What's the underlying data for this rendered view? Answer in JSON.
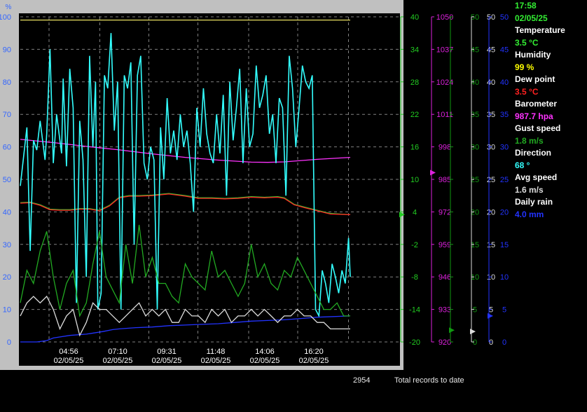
{
  "status": {
    "time": "17:58",
    "date": "02/05/25",
    "readings": [
      {
        "label": "Temperature",
        "value": "3.5 °C",
        "color": "#33ee33"
      },
      {
        "label": "Humidity",
        "value": "99 %",
        "color": "#ffff00"
      },
      {
        "label": "Dew point",
        "value": "3.5 °C",
        "color": "#ff2020"
      },
      {
        "label": "Barometer",
        "value": "987.7 hpa",
        "color": "#ff33ff"
      },
      {
        "label": "Gust speed",
        "value": "1.8 m/s",
        "color": "#22aa22"
      },
      {
        "label": "Direction",
        "value": "68 °",
        "color": "#33ffff"
      },
      {
        "label": "Avg speed",
        "value": "1.6 m/s",
        "color": "#dddddd"
      },
      {
        "label": "Daily rain",
        "value": "4.0 mm",
        "color": "#2233ff"
      }
    ]
  },
  "footer": {
    "record_count": "2954",
    "record_label": "Total records to date"
  },
  "chart_data": {
    "type": "line",
    "grid": true,
    "x_ticks": [
      {
        "time": "04:56",
        "date": "02/05/25"
      },
      {
        "time": "07:10",
        "date": "02/05/25"
      },
      {
        "time": "09:31",
        "date": "02/05/25"
      },
      {
        "time": "11:48",
        "date": "02/05/25"
      },
      {
        "time": "14:06",
        "date": "02/05/25"
      },
      {
        "time": "16:20",
        "date": "02/05/25"
      }
    ],
    "axes": [
      {
        "id": "humidity",
        "unit": "%",
        "min": 0,
        "max": 100,
        "color": "#3366ff",
        "ticks": [
          "0",
          "10",
          "20",
          "30",
          "40",
          "50",
          "60",
          "70",
          "80",
          "90",
          "100"
        ]
      },
      {
        "id": "temperature",
        "min": -20,
        "max": 40,
        "color": "#22cc22",
        "ticks": [
          "-20",
          "-14",
          "-8",
          "-2",
          "4",
          "10",
          "16",
          "22",
          "28",
          "34",
          "40"
        ]
      },
      {
        "id": "barometer",
        "min": 920,
        "max": 1050,
        "color": "#dd22dd",
        "ticks": [
          "920",
          "933",
          "946",
          "959",
          "972",
          "985",
          "998",
          "1011",
          "1024",
          "1037",
          "1050"
        ]
      },
      {
        "id": "gust",
        "min": 0,
        "max": 50,
        "color": "#119911",
        "ticks": [
          "0",
          "5",
          "10",
          "15",
          "20",
          "25",
          "30",
          "35",
          "40",
          "45",
          "50"
        ]
      },
      {
        "id": "avg_speed",
        "min": 0,
        "max": 50,
        "color": "#dddddd",
        "ticks": [
          "0",
          "5",
          "10",
          "15",
          "20",
          "25",
          "30",
          "35",
          "40",
          "45",
          "50"
        ]
      },
      {
        "id": "rain",
        "min": 0,
        "max": 50,
        "color": "#2233ff",
        "ticks": [
          "0",
          "5",
          "10",
          "15",
          "20",
          "25",
          "30",
          "35",
          "40",
          "45",
          "50"
        ]
      }
    ],
    "current_markers": [
      {
        "axis": "temperature",
        "value": 3.5
      },
      {
        "axis": "barometer",
        "value": 987.7
      },
      {
        "axis": "gust",
        "value": 1.8
      },
      {
        "axis": "avg_speed",
        "value": 1.6
      },
      {
        "axis": "rain",
        "value": 4.0
      }
    ],
    "series": [
      {
        "name": "Humidity",
        "axis": "humidity",
        "color": "#e8e060",
        "x": [
          0,
          100
        ],
        "values": [
          99,
          99
        ]
      },
      {
        "name": "Barometer",
        "axis": "barometer",
        "color": "#ff33ff",
        "x": [
          0,
          10,
          20,
          30,
          40,
          50,
          60,
          70,
          75,
          80,
          90,
          100
        ],
        "values": [
          1001,
          999.7,
          998.2,
          996.8,
          995.2,
          993.8,
          992.7,
          991.9,
          991.8,
          992,
          993,
          993.8
        ]
      },
      {
        "name": "Temperature",
        "axis": "temperature",
        "color": "#33cc33",
        "x": [
          0,
          3,
          6,
          9,
          12,
          15,
          18,
          21,
          24,
          27,
          30,
          33,
          36,
          40,
          45,
          50,
          54,
          58,
          62,
          66,
          70,
          74,
          78,
          80,
          83,
          86,
          90,
          94,
          100
        ],
        "values": [
          5.7,
          5.8,
          5.3,
          4.5,
          4.4,
          4.4,
          4.6,
          4.6,
          4.3,
          5.2,
          6.7,
          7.0,
          7.0,
          7.1,
          7.4,
          7.0,
          6.6,
          6.6,
          6.5,
          6.6,
          6.8,
          6.7,
          6.8,
          6.6,
          5.4,
          4.9,
          4.3,
          3.7,
          3.5
        ]
      },
      {
        "name": "Dew point",
        "axis": "temperature",
        "color": "#ff2020",
        "x": [
          0,
          3,
          6,
          9,
          12,
          15,
          18,
          21,
          24,
          27,
          30,
          33,
          36,
          40,
          45,
          50,
          54,
          58,
          62,
          66,
          70,
          74,
          78,
          80,
          83,
          86,
          90,
          94,
          100
        ],
        "values": [
          5.6,
          5.7,
          5.2,
          4.4,
          4.3,
          4.3,
          4.5,
          4.5,
          4.2,
          5.1,
          6.6,
          6.9,
          6.9,
          7.0,
          7.3,
          6.9,
          6.5,
          6.5,
          6.4,
          6.5,
          6.7,
          6.6,
          6.7,
          6.5,
          5.3,
          4.8,
          4.2,
          3.6,
          3.5
        ]
      },
      {
        "name": "Direction",
        "axis": "humidity",
        "color": "#33ffff",
        "x": [
          0,
          2,
          3,
          4,
          5,
          6,
          7.5,
          8,
          9,
          10,
          11,
          12.5,
          13,
          14,
          15,
          16,
          17,
          18,
          19,
          20,
          21,
          22,
          22.8,
          23.5,
          24.5,
          25.5,
          26.5,
          27.5,
          28.5,
          29.5,
          30.5,
          31.5,
          32.5,
          33.5,
          34.5,
          35.5,
          36.5,
          37.5,
          38.5,
          39.5,
          40.5,
          41.5,
          42.5,
          43.5,
          44.5,
          45.5,
          46.5,
          47.5,
          48.5,
          49.5,
          50.5,
          51.5,
          52.5,
          53.5,
          54.5,
          55.5,
          56.5,
          57.5,
          58.5,
          59.5,
          60.5,
          61.5,
          62.5,
          63.5,
          64.5,
          65.5,
          66.5,
          67.5,
          68.5,
          69.5,
          70.5,
          71.5,
          72.5,
          73.5,
          74.5,
          75.5,
          76.5,
          77.5,
          78.5,
          79.5,
          80.5,
          81.5,
          82.5,
          83.5,
          84.5,
          85.5,
          86.5,
          87.5,
          88.5,
          89.5,
          90.5,
          91.5,
          92.5,
          93.5,
          94.5,
          95.5,
          96.5,
          97.5,
          98.5,
          99.5,
          100
        ],
        "values": [
          48,
          66,
          28,
          62,
          59,
          68,
          56,
          64,
          90,
          55,
          70,
          58,
          81,
          54,
          84,
          72,
          12,
          68,
          56,
          20,
          88,
          60,
          80,
          10,
          15,
          82,
          78,
          95,
          65,
          80,
          10,
          82,
          78,
          86,
          30,
          82,
          88,
          55,
          50,
          60,
          56,
          10,
          66,
          50,
          75,
          58,
          65,
          56,
          70,
          60,
          65,
          55,
          40,
          72,
          60,
          78,
          64,
          58,
          55,
          70,
          58,
          76,
          45,
          80,
          62,
          72,
          84,
          55,
          78,
          60,
          64,
          85,
          72,
          76,
          82,
          64,
          70,
          55,
          75,
          72,
          45,
          88,
          78,
          60,
          72,
          85,
          80,
          78,
          82,
          10,
          8,
          22,
          18,
          12,
          24,
          20,
          15,
          22,
          18,
          32,
          20
        ]
      },
      {
        "name": "Rain",
        "axis": "rain",
        "color": "#2233ff",
        "x": [
          0,
          5,
          8,
          10,
          15,
          20,
          25,
          28,
          30,
          35,
          40,
          45,
          50,
          55,
          60,
          65,
          70,
          75,
          80,
          85,
          90,
          95,
          100
        ],
        "values": [
          0,
          0,
          0.2,
          0.6,
          1.0,
          1.2,
          1.6,
          1.9,
          2.0,
          2.2,
          2.3,
          2.5,
          2.6,
          2.7,
          2.8,
          3.0,
          3.2,
          3.3,
          3.4,
          3.6,
          3.8,
          3.9,
          4.0
        ]
      },
      {
        "name": "Gust",
        "axis": "gust",
        "color": "#22aa22",
        "x": [
          0,
          2,
          4,
          6,
          8,
          10,
          12,
          14,
          16,
          18,
          20,
          22,
          24,
          26,
          28,
          30,
          32,
          34,
          36,
          38,
          40,
          42,
          44,
          46,
          48,
          50,
          52,
          54,
          56,
          58,
          60,
          62,
          64,
          66,
          68,
          70,
          72,
          74,
          76,
          78,
          80,
          82,
          84,
          86,
          88,
          90,
          92,
          94,
          96,
          98,
          100
        ],
        "values": [
          6,
          11,
          9,
          14,
          17,
          10,
          5,
          9,
          11,
          4,
          6,
          12,
          17,
          10,
          8,
          6,
          15,
          9,
          18,
          10,
          13,
          9,
          9,
          7,
          6,
          12,
          10,
          9,
          8,
          14,
          10,
          11,
          9,
          7,
          9,
          15,
          10,
          12,
          9,
          8,
          11,
          10,
          13,
          11,
          9,
          7,
          5,
          5,
          6,
          4,
          4
        ]
      },
      {
        "name": "Avg speed",
        "axis": "avg_speed",
        "color": "#dddddd",
        "x": [
          0,
          2,
          4,
          6,
          8,
          10,
          12,
          14,
          16,
          18,
          20,
          22,
          24,
          26,
          28,
          30,
          32,
          34,
          36,
          38,
          40,
          42,
          44,
          46,
          48,
          50,
          52,
          54,
          56,
          58,
          60,
          62,
          64,
          66,
          68,
          70,
          72,
          74,
          76,
          78,
          80,
          82,
          84,
          86,
          88,
          90,
          92,
          94,
          96,
          98,
          100
        ],
        "values": [
          4,
          6,
          7,
          6,
          7,
          5,
          2,
          4,
          5,
          1,
          3,
          6,
          5,
          5,
          4,
          3,
          4,
          5,
          6,
          4,
          5,
          4,
          5,
          3,
          3,
          5,
          4,
          4,
          3,
          5,
          4,
          5,
          3,
          4,
          4,
          5,
          4,
          5,
          4,
          3,
          4,
          4,
          5,
          4,
          4,
          3,
          3,
          2,
          2,
          2,
          2
        ]
      }
    ]
  }
}
